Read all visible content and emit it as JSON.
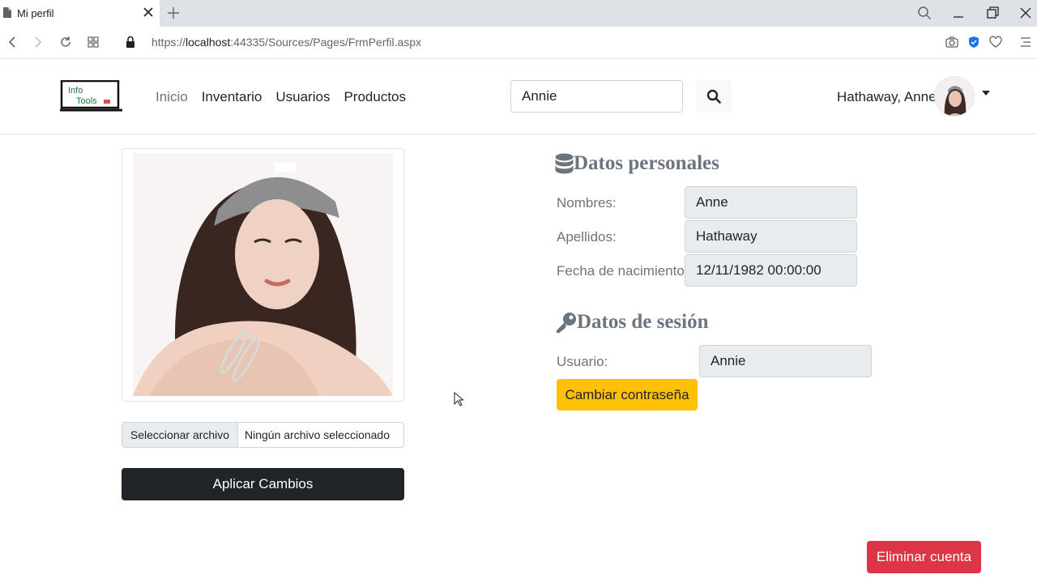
{
  "browser": {
    "tab_title": "Mi perfil",
    "url_prefix": "https://",
    "url_host": "localhost",
    "url_rest": ":44335/Sources/Pages/FrmPerfil.aspx"
  },
  "navbar": {
    "links": [
      "Inicio",
      "Inventario",
      "Usuarios",
      "Productos"
    ],
    "active_link": "Inicio",
    "search_value": "Annie",
    "user_display": "Hathaway, Anne"
  },
  "profile": {
    "file_button": "Seleccionar archivo",
    "file_status": "Ningún archivo seleccionado",
    "apply_label": "Aplicar Cambios"
  },
  "personal": {
    "title": "Datos personales",
    "nombres_label": "Nombres:",
    "nombres_value": "Anne",
    "apellidos_label": "Apellidos:",
    "apellidos_value": "Hathaway",
    "fecha_label": "Fecha de nacimiento:",
    "fecha_value": "12/11/1982 00:00:00"
  },
  "session": {
    "title": "Datos de sesión",
    "usuario_label": "Usuario:",
    "usuario_value": "Annie",
    "change_password_label": "Cambiar contraseña"
  },
  "delete_label": "Eliminar cuenta",
  "colors": {
    "primary_dark": "#212529",
    "warning": "#ffc107",
    "danger": "#dc3545",
    "muted": "#6c757d"
  },
  "icons": [
    "page-icon",
    "close-icon",
    "plus-icon",
    "search-icon",
    "minimize-icon",
    "restore-icon",
    "lock-icon",
    "database-icon",
    "key-icon",
    "camera-icon",
    "heart-icon",
    "shield-icon",
    "menu-icon"
  ]
}
